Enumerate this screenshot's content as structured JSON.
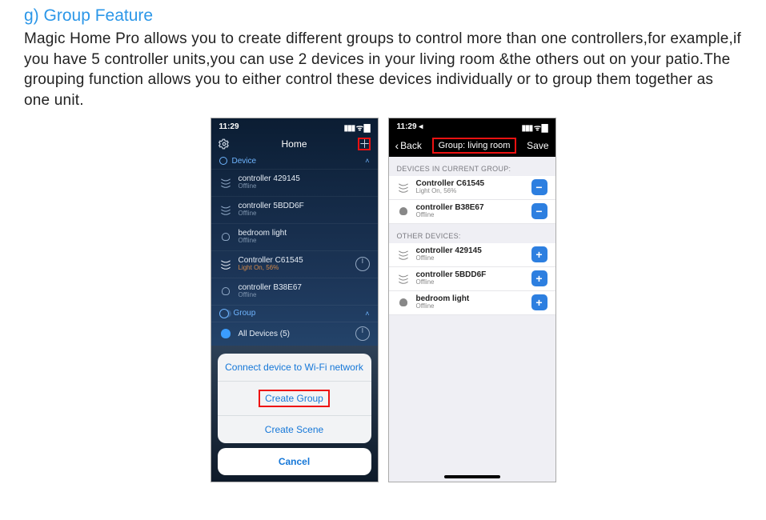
{
  "heading": "g) Group Feature",
  "body": "Magic Home Pro allows you to create different groups to control more than one controllers,for example,if you have 5 controller units,you can use 2 devices in your living room &the others out on your patio.The grouping function allows you to either control these devices individually or to group them together as one unit.",
  "phone1": {
    "time": "11:29",
    "status_icons": "▮▮▮ ᯤ ▇",
    "title": "Home",
    "sect_device": "Device",
    "devices": [
      {
        "name": "controller 429145",
        "sub": "Offline"
      },
      {
        "name": "controller 5BDD6F",
        "sub": "Offline"
      },
      {
        "name": "bedroom light",
        "sub": "Offline"
      },
      {
        "name": "Controller C61545",
        "sub": "Light On, 56%"
      },
      {
        "name": "controller B38E67",
        "sub": "Offline"
      }
    ],
    "sect_group": "Group",
    "all_devices": "All Devices (5)",
    "sheet": {
      "opt1": "Connect device to Wi-Fi network",
      "opt2": "Create Group",
      "opt3": "Create Scene",
      "cancel": "Cancel"
    }
  },
  "phone2": {
    "time": "11:29 ◂",
    "status_icons": "▮▮▮ ᯤ ▇",
    "back": "Back",
    "title": "Group: living room",
    "save": "Save",
    "sect_in": "DEVICES IN CURRENT GROUP:",
    "in_group": [
      {
        "name": "Controller C61545",
        "sub": "Light On, 56%"
      },
      {
        "name": "controller B38E67",
        "sub": "Offline"
      }
    ],
    "sect_other": "OTHER DEVICES:",
    "other": [
      {
        "name": "controller 429145",
        "sub": "Offline"
      },
      {
        "name": "controller 5BDD6F",
        "sub": "Offline"
      },
      {
        "name": "bedroom light",
        "sub": "Offline"
      }
    ]
  }
}
